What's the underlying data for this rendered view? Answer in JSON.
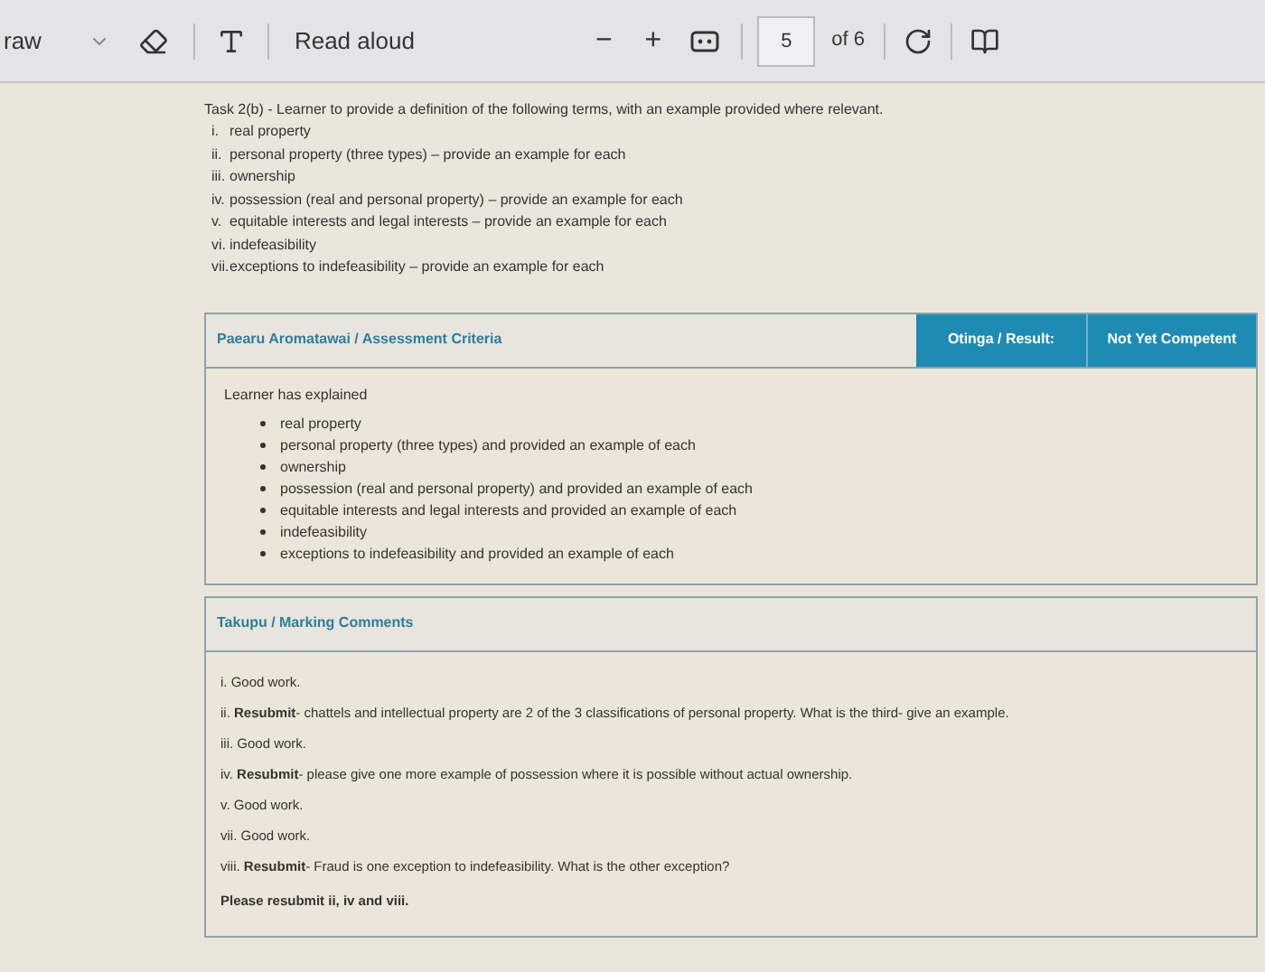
{
  "toolbar": {
    "draw_label": "raw",
    "read_aloud": "Read aloud",
    "zoom_out": "−",
    "zoom_in": "+",
    "page_number": "5",
    "page_count": "of 6"
  },
  "task": {
    "heading": "Task 2(b) - Learner to provide a definition of the following terms, with an example provided where relevant.",
    "items": [
      {
        "numeral": "i.",
        "text": "real property"
      },
      {
        "numeral": "ii.",
        "text": "personal property (three types) – provide an example for each"
      },
      {
        "numeral": "iii.",
        "text": "ownership"
      },
      {
        "numeral": "iv.",
        "text": "possession (real and personal property) – provide an example for each"
      },
      {
        "numeral": "v.",
        "text": "equitable interests and legal interests – provide an example for each"
      },
      {
        "numeral": "vi.",
        "text": "indefeasibility"
      },
      {
        "numeral": "vii.",
        "text": "exceptions to indefeasibility – provide an example for each"
      }
    ]
  },
  "criteria": {
    "title": "Paearu Aromatawai / Assessment Criteria",
    "result_label": "Otinga / Result:",
    "result_value": "Not Yet Competent",
    "intro": "Learner has explained",
    "bullets": [
      "real property",
      "personal property (three types) and provided an example of each",
      "ownership",
      "possession (real and personal property) and provided an example of each",
      "equitable interests and legal interests and provided an example of each",
      "indefeasibility",
      "exceptions to indefeasibility and provided an example of each"
    ]
  },
  "comments": {
    "title": "Takupu / Marking Comments",
    "items": [
      {
        "kind": "comment",
        "text": "i. Good work."
      },
      {
        "kind": "comment",
        "text": "ii. **Resubmit**- chattels and intellectual property are 2 of the 3 classifications of personal property. What is the third- give an example."
      },
      {
        "kind": "comment",
        "text": "iii. Good work."
      },
      {
        "kind": "comment",
        "text": "iv. **Resubmit**- please give one more example of possession where it is possible without actual ownership."
      },
      {
        "kind": "comment",
        "text": "v. Good work."
      },
      {
        "kind": "comment",
        "text": "vii. Good work."
      },
      {
        "kind": "comment",
        "text": "viii. **Resubmit**- Fraud is one exception to indefeasibility. What is the other exception?"
      },
      {
        "kind": "note",
        "text": "**Please resubmit ii, iv and viii.**"
      }
    ]
  }
}
